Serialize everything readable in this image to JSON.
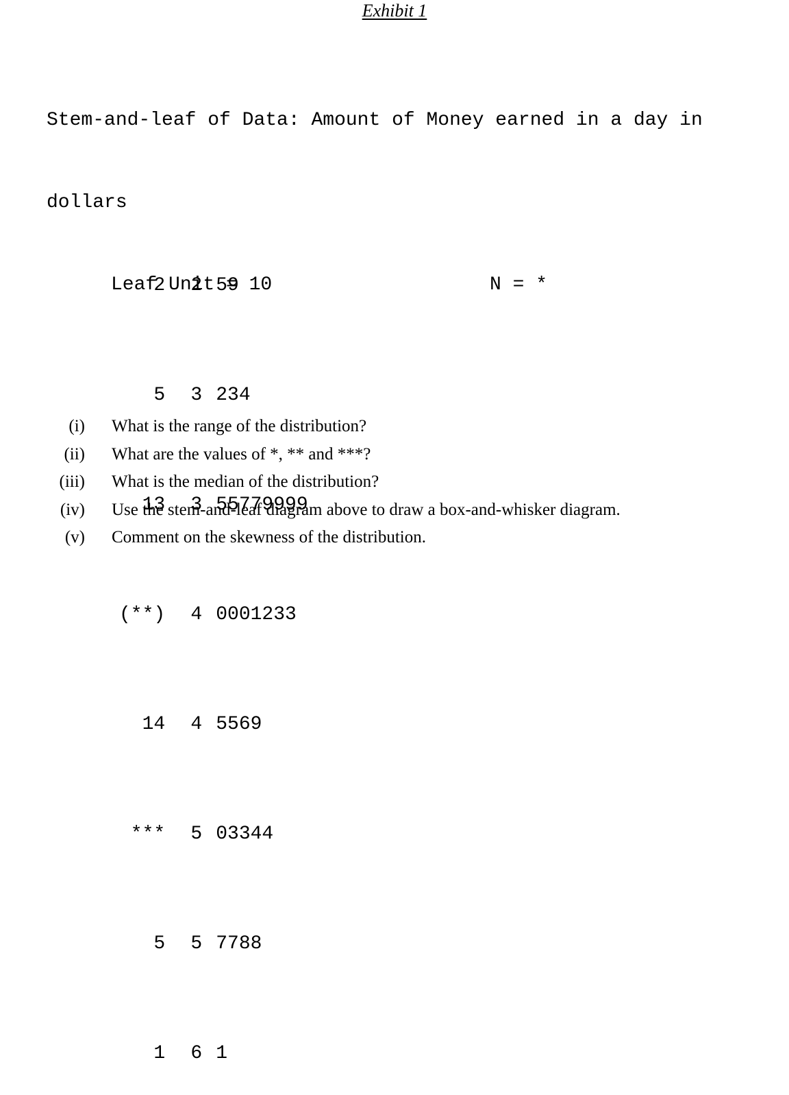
{
  "exhibit": {
    "title": "Exhibit 1"
  },
  "stem_and_leaf": {
    "header_line_1": "Stem-and-leaf of Data: Amount of Money earned in a day in",
    "header_line_2": "dollars",
    "leaf_unit": "Leaf Unit = 10",
    "n_value": "N = *",
    "rows": [
      {
        "count": "2",
        "stem": "2",
        "leaves": "59"
      },
      {
        "count": "5",
        "stem": "3",
        "leaves": "234"
      },
      {
        "count": "13",
        "stem": "3",
        "leaves": "55779999"
      },
      {
        "count": "(**)",
        "stem": "4",
        "leaves": "0001233"
      },
      {
        "count": "14",
        "stem": "4",
        "leaves": "5569"
      },
      {
        "count": "***",
        "stem": "5",
        "leaves": "03344"
      },
      {
        "count": "5",
        "stem": "5",
        "leaves": "7788"
      },
      {
        "count": "1",
        "stem": "6",
        "leaves": "1"
      }
    ]
  },
  "questions": [
    {
      "label": "(i)",
      "text": "What is the range of the distribution?"
    },
    {
      "label": "(ii)",
      "text": "What are the values of *, ** and ***?"
    },
    {
      "label": "(iii)",
      "text": "What is the median of the distribution?"
    },
    {
      "label": "(iv)",
      "text": "Use the stem-and-leaf diagram above to draw a box-and-whisker diagram."
    },
    {
      "label": "(v)",
      "text": "Comment on the skewness of the distribution."
    }
  ],
  "colors": {
    "text": "#000000",
    "background": "#ffffff"
  }
}
